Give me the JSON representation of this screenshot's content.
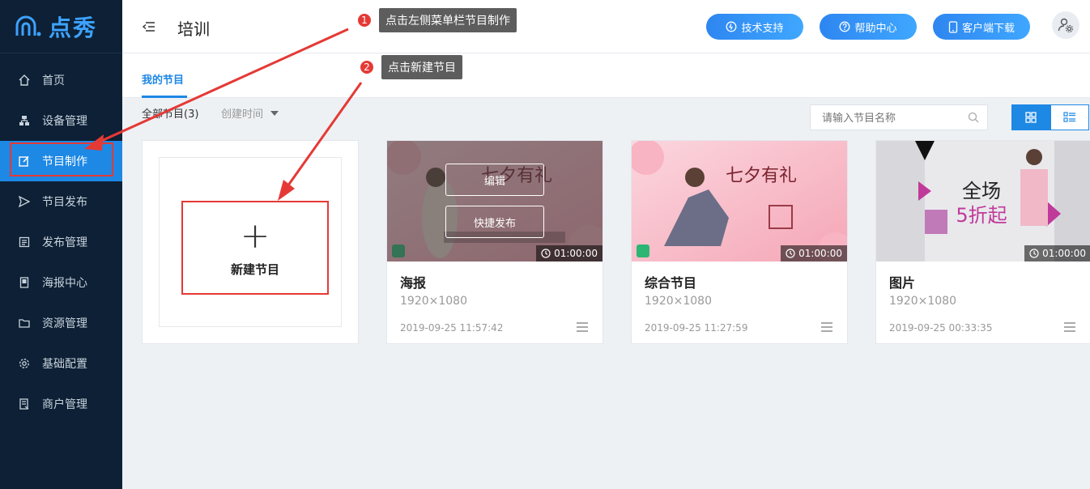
{
  "brand": {
    "name": "点秀"
  },
  "sidebar": {
    "items": [
      {
        "label": "首页",
        "icon": "home-icon"
      },
      {
        "label": "设备管理",
        "icon": "device-icon"
      },
      {
        "label": "节目制作",
        "icon": "edit-icon",
        "active": true
      },
      {
        "label": "节目发布",
        "icon": "send-icon"
      },
      {
        "label": "发布管理",
        "icon": "publish-icon"
      },
      {
        "label": "海报中心",
        "icon": "poster-icon"
      },
      {
        "label": "资源管理",
        "icon": "folder-icon"
      },
      {
        "label": "基础配置",
        "icon": "gear-icon"
      },
      {
        "label": "商户管理",
        "icon": "merchant-icon"
      }
    ]
  },
  "header": {
    "title": "培训",
    "buttons": {
      "support": "技术支持",
      "help": "帮助中心",
      "download": "客户端下载"
    }
  },
  "tabs": {
    "active": "我的节目"
  },
  "filter": {
    "count_label": "全部节目(3)",
    "sort_label": "创建时间",
    "search_placeholder": "请输入节目名称"
  },
  "new_card": {
    "label": "新建节目"
  },
  "cards": [
    {
      "title": "海报",
      "size": "1920×1080",
      "date": "2019-09-25 11:57:42",
      "duration": "01:00:00",
      "edit_label": "编辑",
      "publish_label": "快捷发布"
    },
    {
      "title": "综合节目",
      "size": "1920×1080",
      "date": "2019-09-25 11:27:59",
      "duration": "01:00:00"
    },
    {
      "title": "图片",
      "size": "1920×1080",
      "date": "2019-09-25 00:33:35",
      "duration": "01:00:00"
    }
  ],
  "callouts": [
    {
      "number": "1",
      "text": "点击左侧菜单栏节目制作"
    },
    {
      "number": "2",
      "text": "点击新建节目"
    }
  ],
  "colors": {
    "sidebar_bg": "#0d2035",
    "accent": "#1e88e5",
    "annotation_red": "#e53935"
  }
}
